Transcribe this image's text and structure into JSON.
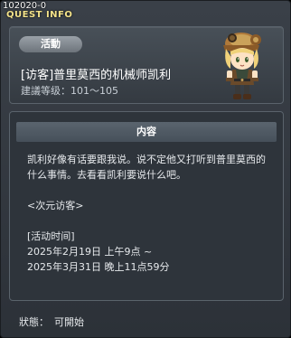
{
  "window": {
    "id": "102020-0",
    "title": "QUEST INFO"
  },
  "header": {
    "category": "活動",
    "quest_name": "[访客]普里莫西的机械师凯利",
    "level_label": "建議等级：",
    "level_range": "101～105",
    "npc_icon": "npc-portrait-icon"
  },
  "content": {
    "heading": "内容",
    "description": "凯利好像有话要跟我说。说不定他又打听到普里莫西的什么事情。去看看凯利要说什么吧。",
    "tag": "<次元访客>",
    "period_label": "[活动时间]",
    "start": "2025年2月19日 上午9点 ~",
    "end": "2025年3月31日 晚上11点59分"
  },
  "status": {
    "label": "狀態：",
    "value": "可開始"
  },
  "colors": {
    "window_bg": "#33393f",
    "title_yellow": "#f4e38a",
    "badge": "#8a9198",
    "content_header": "#505a64"
  }
}
